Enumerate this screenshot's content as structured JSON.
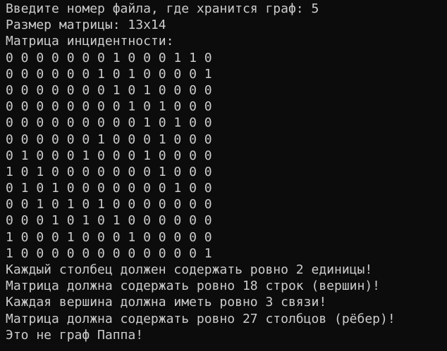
{
  "console": {
    "prompt": {
      "label": "Введите номер файла, где хранится граф:",
      "input_value": "5"
    },
    "matrix_size_line": "Размер матрицы: 13x14",
    "matrix_header": "Матрица инцидентности:",
    "matrix_rows": [
      "0 0 0 0 0 0 0 1 0 0 0 1 1 0",
      "0 0 0 0 0 0 1 0 1 0 0 0 0 1",
      "0 0 0 0 0 0 0 1 0 1 0 0 0 0",
      "0 0 0 0 0 0 0 0 1 0 1 0 0 0",
      "0 0 0 0 0 0 0 0 0 1 0 1 0 0",
      "0 0 0 0 0 0 1 0 0 0 1 0 0 0",
      "0 1 0 0 0 1 0 0 0 1 0 0 0 0",
      "1 0 1 0 0 0 0 0 0 0 1 0 0 0",
      "0 1 0 1 0 0 0 0 0 0 0 1 0 0",
      "0 0 1 0 1 0 1 0 0 0 0 0 0 0",
      "0 0 0 1 0 1 0 1 0 0 0 0 0 0",
      "1 0 0 0 1 0 0 0 1 0 0 0 0 0",
      "1 0 0 0 0 0 0 0 0 0 0 0 0 1"
    ],
    "messages": [
      "Каждый столбец должен содержать ровно 2 единицы!",
      "Матрица должна содержать ровно 18 строк (вершин)!",
      "Каждая вершина должна иметь ровно 3 связи!",
      "Матрица должна содержать ровно 27 столбцов (рёбер)!",
      "Это не граф Паппа!"
    ]
  }
}
